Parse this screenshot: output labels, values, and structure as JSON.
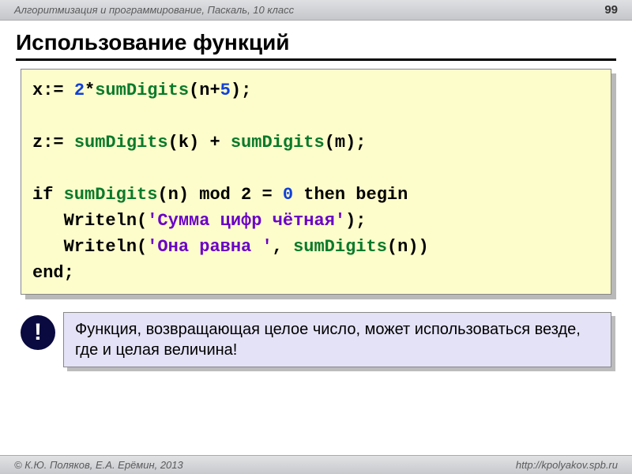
{
  "header": {
    "breadcrumb": "Алгоритмизация и программирование, Паскаль, 10 класс",
    "page_number": "99"
  },
  "title": "Использование функций",
  "code": {
    "parts": {
      "x_assign": "x:= ",
      "two": "2",
      "star": "*",
      "sumDigits": "sumDigits",
      "lparen": "(",
      "rparen": ")",
      "n_plus": "n+",
      "five": "5",
      "semi": ";",
      "z_assign": "z:= ",
      "k": "k",
      "plus_sp": " + ",
      "m": "m",
      "if_": "if ",
      "n": "n",
      "mod_part": " mod 2 = ",
      "zero": "0",
      "then_begin": " then begin",
      "indent": "   ",
      "writeln": "Writeln(",
      "str1": "'Сумма цифр чётная'",
      "writeln2": "Writeln(",
      "str2": "'Она равна '",
      "comma_sp": ", ",
      "end_": "end;"
    }
  },
  "note": {
    "bang": "!",
    "text": "Функция, возвращающая целое число, может использоваться везде, где и целая величина!"
  },
  "footer": {
    "authors": "© К.Ю. Поляков, Е.А. Ерёмин, 2013",
    "url": "http://kpolyakov.spb.ru"
  }
}
